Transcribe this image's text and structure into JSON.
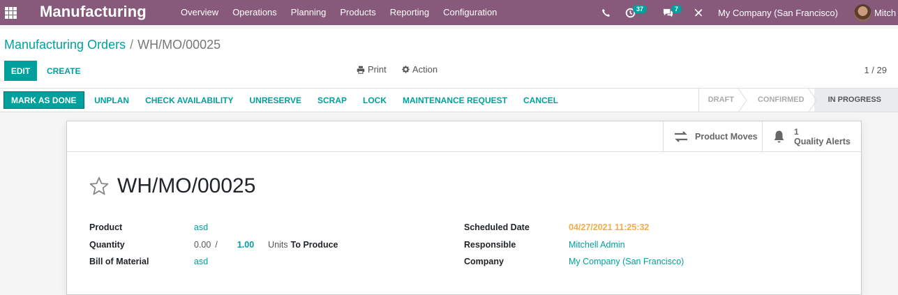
{
  "navbar": {
    "app_title": "Manufacturing",
    "menu": [
      "Overview",
      "Operations",
      "Planning",
      "Products",
      "Reporting",
      "Configuration"
    ],
    "activity_count": "37",
    "chat_count": "7",
    "company": "My Company (San Francisco)",
    "user": "Mitchell Admin",
    "user_visible": "Mitch"
  },
  "breadcrumb": {
    "parent": "Manufacturing Orders",
    "separator": "/",
    "current": "WH/MO/00025"
  },
  "controls": {
    "edit": "EDIT",
    "create": "CREATE",
    "print": "Print",
    "action": "Action",
    "pager": "1 / 29"
  },
  "statusbar": {
    "mark_done": "MARK AS DONE",
    "buttons": [
      "UNPLAN",
      "CHECK AVAILABILITY",
      "UNRESERVE",
      "SCRAP",
      "LOCK",
      "MAINTENANCE REQUEST",
      "CANCEL"
    ],
    "stages": [
      "DRAFT",
      "CONFIRMED",
      "IN PROGRESS"
    ],
    "active_stage": "IN PROGRESS"
  },
  "smart_buttons": {
    "moves": "Product Moves",
    "alerts_count": "1",
    "alerts": "Quality Alerts"
  },
  "record": {
    "name": "WH/MO/00025",
    "product_label": "Product",
    "product": "asd",
    "quantity_label": "Quantity",
    "qty_produced": "0.00",
    "qty_sep": "/",
    "qty_to_produce": "1.00",
    "uom": "Units",
    "to_produce": "To Produce",
    "bom_label": "Bill of Material",
    "bom": "asd",
    "scheduled_label": "Scheduled Date",
    "scheduled": "04/27/2021 11:25:32",
    "responsible_label": "Responsible",
    "responsible": "Mitchell Admin",
    "company_label": "Company",
    "company": "My Company (San Francisco)"
  },
  "colors": {
    "navbar": "#875a7b",
    "primary": "#00a09d",
    "date_warning": "#f0ad4e"
  }
}
